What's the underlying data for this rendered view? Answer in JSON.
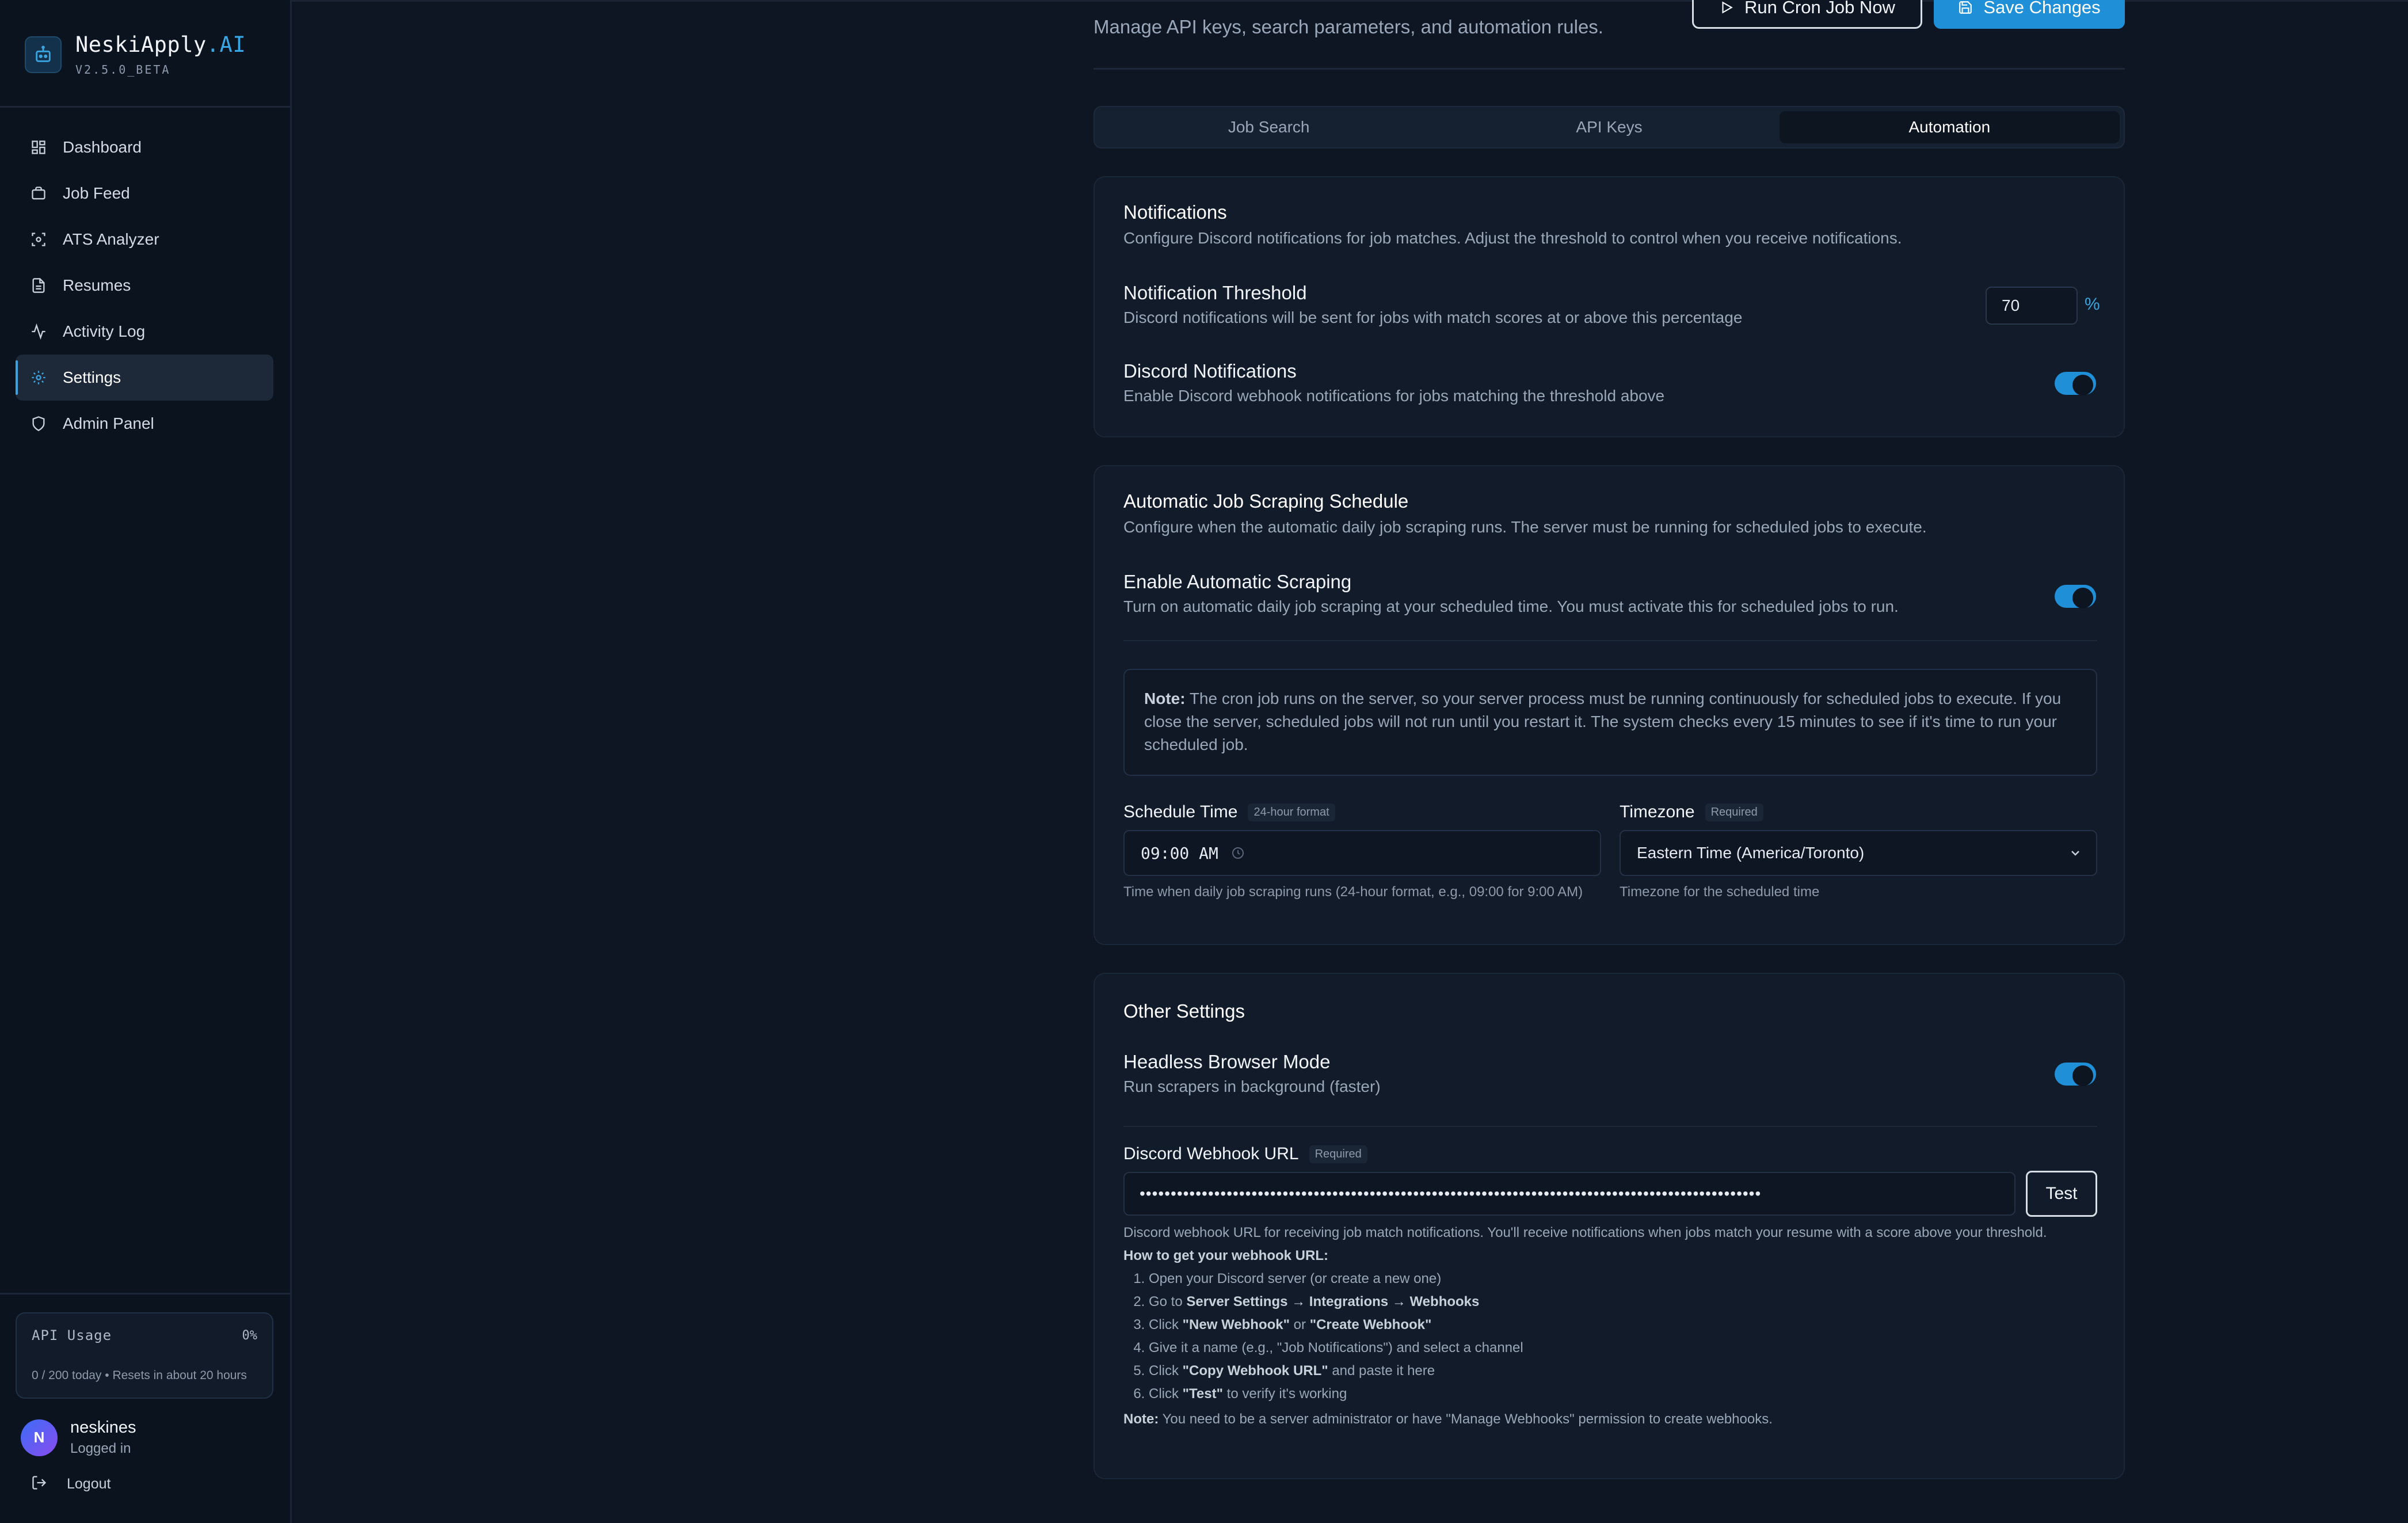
{
  "brand": {
    "name_main": "NeskiApply",
    "name_accent": ".AI",
    "version": "V2.5.0_BETA"
  },
  "nav": {
    "items": [
      {
        "label": "Dashboard",
        "icon": "grid-icon"
      },
      {
        "label": "Job Feed",
        "icon": "briefcase-icon"
      },
      {
        "label": "ATS Analyzer",
        "icon": "scan-icon"
      },
      {
        "label": "Resumes",
        "icon": "document-icon"
      },
      {
        "label": "Activity Log",
        "icon": "activity-icon"
      },
      {
        "label": "Settings",
        "icon": "gear-icon",
        "active": true
      },
      {
        "label": "Admin Panel",
        "icon": "shield-icon"
      }
    ]
  },
  "api_usage": {
    "label": "API Usage",
    "percent": "0%",
    "meta": "0 / 200 today • Resets in about 20 hours"
  },
  "user": {
    "initial": "N",
    "name": "neskines",
    "status": "Logged in",
    "logout_label": "Logout"
  },
  "header": {
    "subtitle": "Manage API keys, search parameters, and automation rules.",
    "run_cron_label": "Run Cron Job Now",
    "save_label": "Save Changes"
  },
  "tabs": [
    {
      "label": "Job Search",
      "active": false
    },
    {
      "label": "API Keys",
      "active": false
    },
    {
      "label": "Automation",
      "active": true
    }
  ],
  "notifications": {
    "title": "Notifications",
    "desc": "Configure Discord notifications for job matches. Adjust the threshold to control when you receive notifications.",
    "threshold_title": "Notification Threshold",
    "threshold_desc": "Discord notifications will be sent for jobs with match scores at or above this percentage",
    "threshold_value": "70",
    "threshold_unit": "%",
    "discord_title": "Discord Notifications",
    "discord_desc": "Enable Discord webhook notifications for jobs matching the threshold above",
    "discord_enabled": true
  },
  "scraping": {
    "title": "Automatic Job Scraping Schedule",
    "desc": "Configure when the automatic daily job scraping runs. The server must be running for scheduled jobs to execute.",
    "enable_title": "Enable Automatic Scraping",
    "enable_desc": "Turn on automatic daily job scraping at your scheduled time. You must activate this for scheduled jobs to run.",
    "enabled": true,
    "note_label": "Note:",
    "note_text": "The cron job runs on the server, so your server process must be running continuously for scheduled jobs to execute. If you close the server, scheduled jobs will not run until you restart it. The system checks every 15 minutes to see if it's time to run your scheduled job.",
    "schedule_label": "Schedule Time",
    "schedule_badge": "24-hour format",
    "schedule_value": "09:00 AM",
    "schedule_helper": "Time when daily job scraping runs (24-hour format, e.g., 09:00 for 9:00 AM)",
    "timezone_label": "Timezone",
    "timezone_badge": "Required",
    "timezone_value": "Eastern Time (America/Toronto)",
    "timezone_helper": "Timezone for the scheduled time"
  },
  "other": {
    "title": "Other Settings",
    "headless_title": "Headless Browser Mode",
    "headless_desc": "Run scrapers in background (faster)",
    "headless_enabled": true,
    "webhook_label": "Discord Webhook URL",
    "webhook_badge": "Required",
    "webhook_masked": "••••••••••••••••••••••••••••••••••••••••••••••••••••••••••••••••••••••••••••••••••••••••••••••••••••",
    "test_label": "Test",
    "webhook_helper": "Discord webhook URL for receiving job match notifications. You'll receive notifications when jobs match your resume with a score above your threshold.",
    "howto_title": "How to get your webhook URL:",
    "steps": [
      {
        "pre": "Open your Discord server (or create a new one)",
        "b1": "",
        "mid": "",
        "b2": "",
        "post": ""
      },
      {
        "pre": "Go to ",
        "b1": "Server Settings → Integrations → Webhooks",
        "mid": "",
        "b2": "",
        "post": ""
      },
      {
        "pre": "Click ",
        "b1": "\"New Webhook\"",
        "mid": " or ",
        "b2": "\"Create Webhook\"",
        "post": ""
      },
      {
        "pre": "Give it a name (e.g., \"Job Notifications\") and select a channel",
        "b1": "",
        "mid": "",
        "b2": "",
        "post": ""
      },
      {
        "pre": "Click ",
        "b1": "\"Copy Webhook URL\"",
        "mid": " and paste it here",
        "b2": "",
        "post": ""
      },
      {
        "pre": "Click ",
        "b1": "\"Test\"",
        "mid": " to verify it's working",
        "b2": "",
        "post": ""
      }
    ],
    "footnote_label": "Note:",
    "footnote_text": " You need to be a server administrator or have \"Manage Webhooks\" permission to create webhooks."
  }
}
